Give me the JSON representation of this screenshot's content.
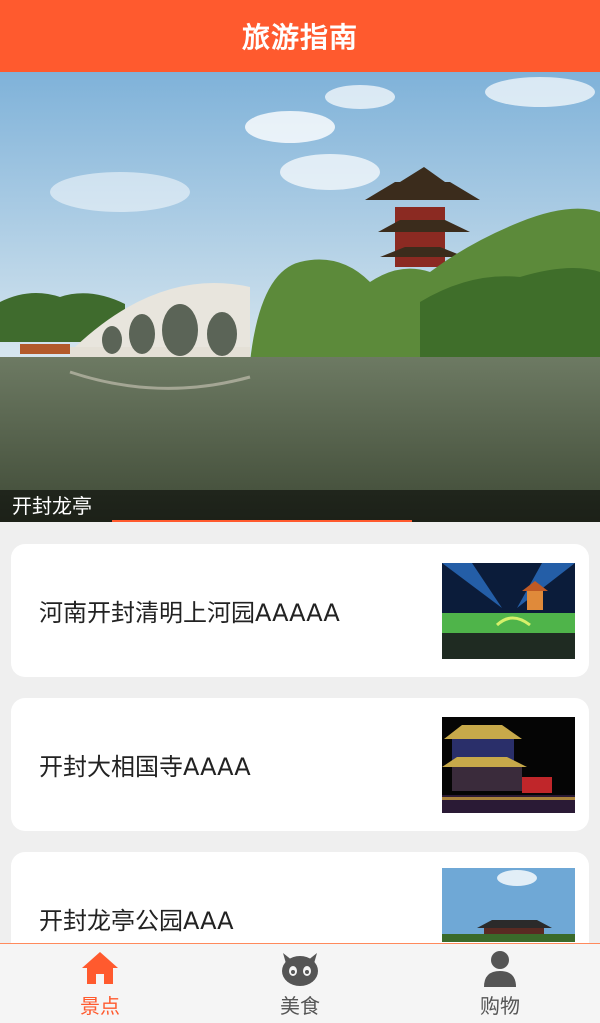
{
  "header": {
    "title": "旅游指南"
  },
  "banner": {
    "caption": "开封龙亭",
    "active_slide": 1
  },
  "list": {
    "items": [
      {
        "title": "河南开封清明上河园AAAAA"
      },
      {
        "title": "开封大相国寺AAAA"
      },
      {
        "title": "开封龙亭公园AAA"
      }
    ]
  },
  "tabbar": {
    "tabs": [
      {
        "label": "景点",
        "icon": "home-icon",
        "active": true
      },
      {
        "label": "美食",
        "icon": "cat-face-icon",
        "active": false
      },
      {
        "label": "购物",
        "icon": "user-icon",
        "active": false
      }
    ]
  },
  "colors": {
    "accent": "#ff5a2e",
    "inactive": "#555555"
  }
}
